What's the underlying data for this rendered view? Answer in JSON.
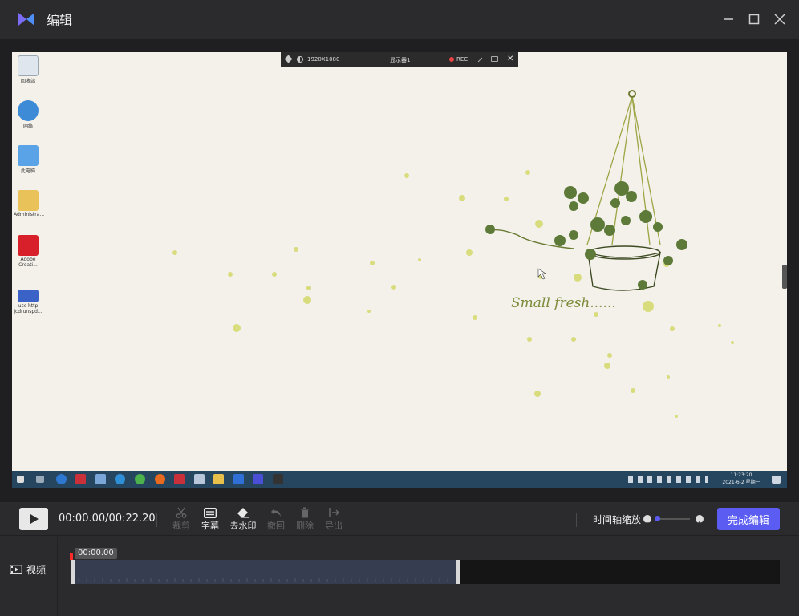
{
  "window": {
    "title": "编辑",
    "logo_icon": "video-editor-logo",
    "minimize_icon": "minimize-icon",
    "maximize_icon": "maximize-icon",
    "close_icon": "close-icon"
  },
  "preview": {
    "desktop_icons": [
      {
        "label": "回收站",
        "icon": "recycle-bin-icon"
      },
      {
        "label": "网络",
        "icon": "network-icon"
      },
      {
        "label": "此电脑",
        "icon": "computer-icon"
      },
      {
        "label": "Administra...",
        "icon": "user-folder-icon"
      },
      {
        "label": "Adobe Creati...",
        "icon": "adobe-creative-cloud-icon"
      },
      {
        "label": "ucc http jcdrunspd...",
        "icon": "shortcut-icon"
      }
    ],
    "record_bar": {
      "resolution": "1920X1080",
      "display": "显示器1",
      "rec_label": "REC"
    },
    "wallpaper_text": "Small fresh......",
    "taskbar": {
      "time": "11:23:20",
      "date": "2021-6-2 星期一"
    }
  },
  "toolbar": {
    "timecode": "00:00.00/00:22.20",
    "tools": [
      {
        "label": "裁剪",
        "icon": "scissors-icon",
        "enabled": false
      },
      {
        "label": "字幕",
        "icon": "subtitle-icon",
        "enabled": true
      },
      {
        "label": "去水印",
        "icon": "eraser-icon",
        "enabled": true
      },
      {
        "label": "撤回",
        "icon": "undo-icon",
        "enabled": false
      },
      {
        "label": "删除",
        "icon": "trash-icon",
        "enabled": false
      },
      {
        "label": "导出",
        "icon": "export-icon",
        "enabled": false
      }
    ],
    "zoom_label": "时间轴缩放",
    "zoom_level": 0.0,
    "done_button": "完成编辑"
  },
  "timeline": {
    "track_label": "视频",
    "track_icon": "film-icon",
    "playhead_time": "00:00.00"
  },
  "colors": {
    "accent": "#5b5cf2",
    "background": "#2b2b2d",
    "clip": "#363d50",
    "playhead": "#ff2a2a"
  }
}
